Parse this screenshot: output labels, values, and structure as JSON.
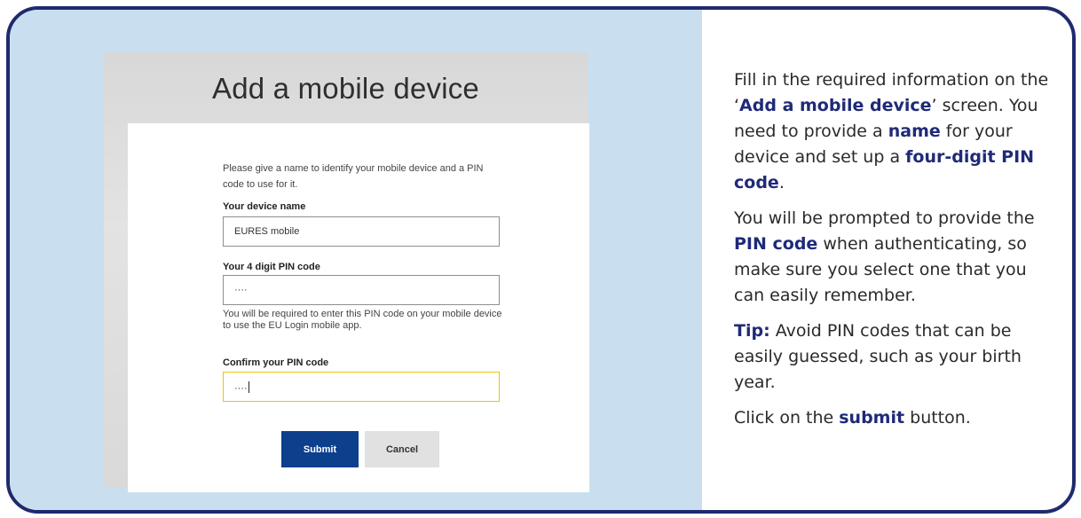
{
  "screenshot": {
    "title": "Add a mobile device",
    "intro": "Please give a name to identify your mobile device and a PIN code to use for it.",
    "device_name": {
      "label": "Your device name",
      "value": "EURES mobile"
    },
    "pin": {
      "label": "Your 4 digit PIN code",
      "value": "····"
    },
    "pin_help": "You will be required to enter this PIN code on your mobile device to use the EU Login mobile app.",
    "confirm_pin": {
      "label": "Confirm your PIN code",
      "value": "····"
    },
    "submit_label": "Submit",
    "cancel_label": "Cancel"
  },
  "instructions": {
    "p1": {
      "a": "Fill in the required information on the ‘",
      "b": "Add a mobile device",
      "c": "’ screen. You need to provide a ",
      "d": "name",
      "e": " for your device and set up a ",
      "f": "four-digit PIN code",
      "g": "."
    },
    "p2": {
      "a": "You will be prompted to provide the ",
      "b": "PIN code",
      "c": " when authenticating, so make sure you select one that you can easily remember."
    },
    "p3": {
      "a": "Tip:",
      "b": " Avoid PIN codes that can be easily guessed, such as your birth year."
    },
    "p4": {
      "a": "Click on the ",
      "b": "submit",
      "c": " button."
    }
  },
  "colors": {
    "frame_border": "#1f2a6e",
    "left_background": "#c9dff0",
    "highlight_text": "#1f2a78",
    "submit_button": "#0c3f8c",
    "focus_border": "#f2c300"
  }
}
